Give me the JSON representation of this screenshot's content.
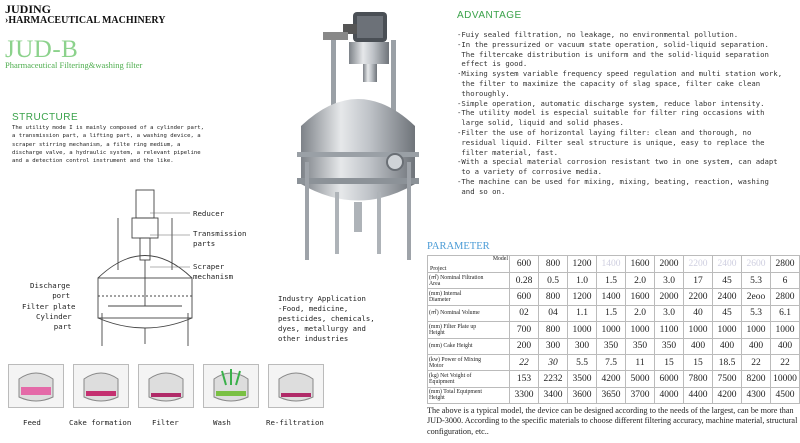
{
  "brand": {
    "line1": "JUDING",
    "line2": "›HARMACEUTICAL MACHINERY"
  },
  "model": "JUD-B",
  "tagline": "Pharmaceutical Filtering&washing filter",
  "structure": {
    "heading": "STRUCTURE",
    "lines": [
      "The utility mode I is mainly composed of a cylinder part,",
      "a transmission part, a lifting part, a washing device, a",
      "scraper stirring mechanism, a filte ring medium, a",
      "discharge valve, a hydraulic system, a relevant pipeline",
      "and a detection control instrument and the like."
    ]
  },
  "advantage": {
    "heading": "ADVANTAGE",
    "items": [
      "-Fuiy sealed filtration, no leakage, no environmental pollution.",
      "-In the pressurized or vacuum state operation, solid-liquid separation.",
      " The filtercake distribution is uniform and the solid-liquid separation\n effect is good.",
      "·Mixing system variable frequency speed regulation and multi station work,\n the filter to maximize the capacity of slag space, filter cake clean\n thoroughly.",
      "-Simple operation, automatic discharge system, reduce labor intensity.",
      "-The utility model is especial suitable for filter ring occasions with\n large solid, liquid and solid phases.",
      "-Filter the use of horizontal laying filter: clean and thorough, no\n residual liquid. Filter seal structure is unique, easy to replace the\n filter material, fast.",
      "-With a special material corrosion resistant two in one system, can adapt\n to a variety of corrosive media.",
      "-The machine can be used for mixing, mixing, beating, reaction, washing\n and so on."
    ]
  },
  "diagram_labels": {
    "reducer": "Reducer",
    "transmission": "Transmission\nparts",
    "scraper": "Scraper\nmechanism",
    "discharge": "Discharge\nport",
    "filter_plate": "Filter plate",
    "cylinder": "Cylinder\npart"
  },
  "industry": "Industry Application\n-Food, medicine,\npesticides, chemicals,\ndyes, metallurgy and\nother industries",
  "stages": [
    "Feed",
    "Cake formation",
    "Filter",
    "Wash",
    "Re-filtration"
  ],
  "parameter": {
    "title": "PARAMETER",
    "header_label_top": "Model",
    "header_label_bottom": "Project",
    "models": [
      "600",
      "800",
      "1200",
      "1400",
      "1600",
      "2000",
      "2200",
      "2400",
      "2600",
      "2800"
    ],
    "faded_models": [
      3,
      6,
      7,
      8
    ],
    "rows": [
      {
        "label": "(㎡) Nominal Filtration\nArea",
        "values": [
          "0.28",
          "0.5",
          "1.0",
          "1.5",
          "2.0",
          "3.0",
          "17",
          "45",
          "5.3",
          "6"
        ]
      },
      {
        "label": "(mm) Internal\nDiameter",
        "values": [
          "600",
          "800",
          "1200",
          "1400",
          "1600",
          "2000",
          "2200",
          "2400",
          "2eoo",
          "2800"
        ]
      },
      {
        "label": "(㎥) Nominal Volume",
        "values": [
          "02",
          "04",
          "1.1",
          "1.5",
          "2.0",
          "3.0",
          "40",
          "45",
          "5.3",
          "6.1"
        ]
      },
      {
        "label": "(mm) Filter Plate up\nHeight",
        "values": [
          "700",
          "800",
          "1000",
          "1000",
          "1000",
          "1100",
          "1000",
          "1000",
          "1000",
          "1000"
        ]
      },
      {
        "label": "(mm) Cake Height",
        "values": [
          "200",
          "300",
          "300",
          "350",
          "350",
          "350",
          "400",
          "400",
          "400",
          "400"
        ]
      },
      {
        "label": "(kw) Power of Mixing\nMotor",
        "values": [
          "22",
          "30",
          "5.5",
          "7.5",
          "11",
          "15",
          "15",
          "18.5",
          "22",
          "22"
        ]
      },
      {
        "label": "(kg) Net Voight of\nEquipment",
        "values": [
          "153",
          "2232",
          "3500",
          "4200",
          "5000",
          "6000",
          "7800",
          "7500",
          "8200",
          "10000"
        ]
      },
      {
        "label": "(mm) Total Equipment\nHeight",
        "values": [
          "3300",
          "3400",
          "3600",
          "3650",
          "3700",
          "4000",
          "4400",
          "4200",
          "4300",
          "4500"
        ]
      }
    ],
    "footnote": "The above is a typical model, the device can be designed according to the needs of the largest, can be more than JUD-3000. According to the specific materials to choose different filtering accuracy, machine material, structural configuration, etc.."
  },
  "colors": {
    "accent_green": "#3aa24a",
    "light_green": "#8cd28c",
    "param_blue": "#4a9bd6",
    "steel": "#b8bcc2"
  }
}
